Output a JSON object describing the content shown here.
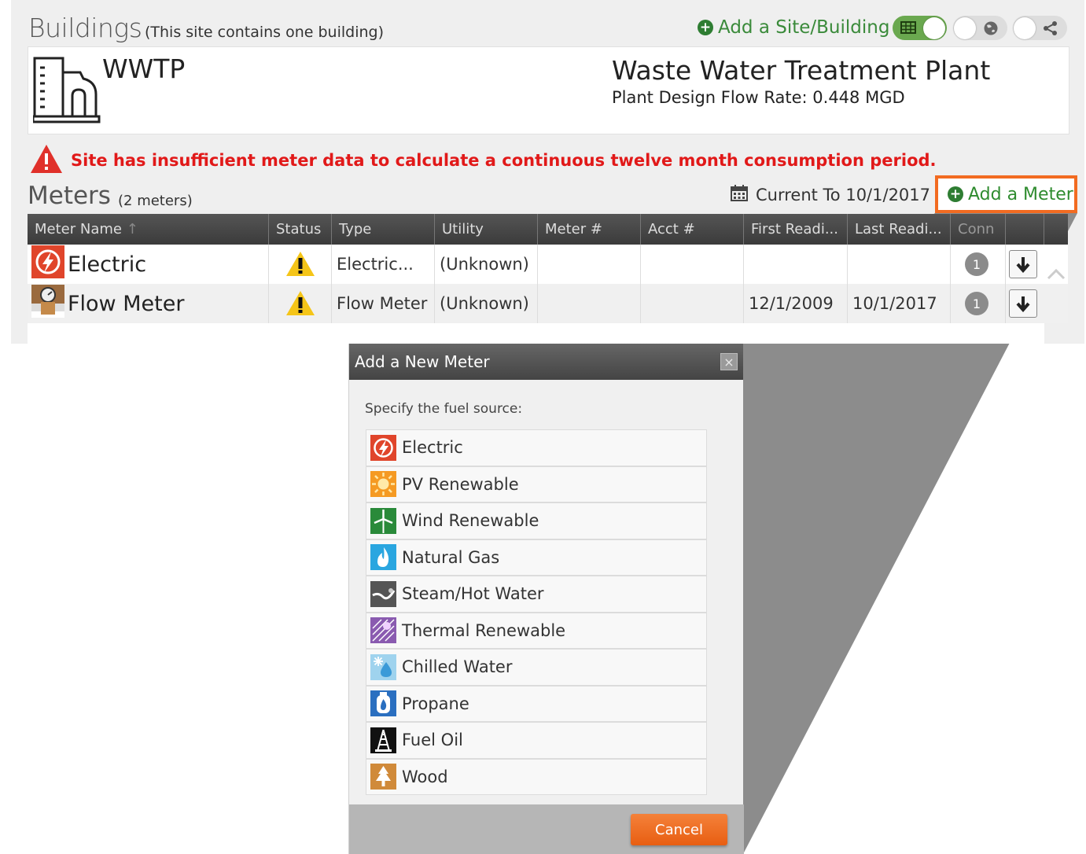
{
  "buildings": {
    "title": "Buildings",
    "subtitle": "(This site contains one building)",
    "add_site_label": "Add a Site/Building",
    "toggles": [
      "table-view-icon",
      "globe-icon",
      "share-icon"
    ]
  },
  "building": {
    "name": "WWTP",
    "plant_title": "Waste Water Treatment Plant",
    "plant_flow": "Plant Design Flow Rate: 0.448 MGD"
  },
  "warning": {
    "text": "Site has insufficient meter data to calculate a continuous twelve month consumption period."
  },
  "meters": {
    "title": "Meters",
    "subtitle": "(2 meters)",
    "current_to": "Current To 10/1/2017",
    "add_meter_label": "Add a Meter",
    "columns": [
      "Meter Name",
      "Status",
      "Type",
      "Utility",
      "Meter #",
      "Acct #",
      "First Readi...",
      "Last Readi...",
      "Conn"
    ],
    "sort_indicator": "↑",
    "rows": [
      {
        "name": "Electric",
        "type": "Electric...",
        "utility": "(Unknown)",
        "meter_no": "",
        "acct_no": "",
        "first": "",
        "last": "",
        "conn": "1",
        "icon": "electric-icon",
        "status_icon": "warning-icon"
      },
      {
        "name": "Flow Meter",
        "type": "Flow Meter",
        "utility": "(Unknown)",
        "meter_no": "",
        "acct_no": "",
        "first": "12/1/2009",
        "last": "10/1/2017",
        "conn": "1",
        "icon": "flow-meter-icon",
        "status_icon": "warning-icon"
      }
    ]
  },
  "modal": {
    "title": "Add a New Meter",
    "close": "×",
    "prompt": "Specify the fuel source:",
    "fuels": [
      {
        "label": "Electric",
        "icon": "electric-icon",
        "color": "#e0452b"
      },
      {
        "label": "PV Renewable",
        "icon": "sun-icon",
        "color": "#f59a23"
      },
      {
        "label": "Wind Renewable",
        "icon": "wind-turbine-icon",
        "color": "#2a8a3a"
      },
      {
        "label": "Natural Gas",
        "icon": "flame-icon",
        "color": "#2aa6e0"
      },
      {
        "label": "Steam/Hot Water",
        "icon": "steam-icon",
        "color": "#555555"
      },
      {
        "label": "Thermal Renewable",
        "icon": "thermal-icon",
        "color": "#8a5bb0"
      },
      {
        "label": "Chilled Water",
        "icon": "snowflake-drop-icon",
        "color": "#7ec4e8"
      },
      {
        "label": "Propane",
        "icon": "propane-tank-icon",
        "color": "#2a6fc0"
      },
      {
        "label": "Fuel Oil",
        "icon": "oil-derrick-icon",
        "color": "#111111"
      },
      {
        "label": "Wood",
        "icon": "tree-icon",
        "color": "#d08a3a"
      }
    ],
    "cancel_label": "Cancel"
  },
  "colors": {
    "accent_green": "#2e8b2e",
    "highlight_orange": "#f26b21",
    "warning_red": "#e11919"
  }
}
